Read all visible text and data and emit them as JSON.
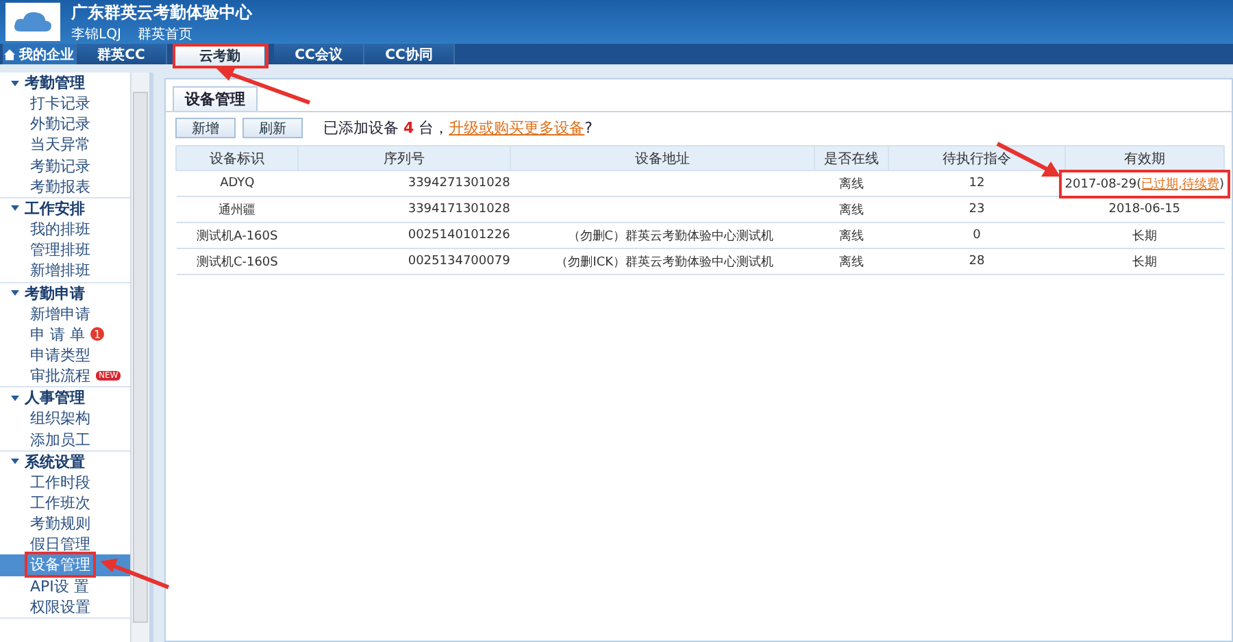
{
  "header": {
    "title": "广东群英云考勤体验中心",
    "user": "李锦LQJ",
    "home_link": "群英首页"
  },
  "nav": [
    {
      "label": "我的企业",
      "kind": "home",
      "selected": false,
      "highlighted": false
    },
    {
      "label": "群英CC",
      "kind": "plain",
      "selected": false,
      "highlighted": false
    },
    {
      "label": "云考勤",
      "kind": "plain",
      "selected": true,
      "highlighted": true
    },
    {
      "label": "CC会议",
      "kind": "plain",
      "selected": false,
      "highlighted": false
    },
    {
      "label": "CC协同",
      "kind": "plain",
      "selected": false,
      "highlighted": false
    }
  ],
  "sidebar": [
    {
      "label": "考勤管理",
      "expanded": true,
      "children": [
        {
          "label": "打卡记录",
          "selected": false
        },
        {
          "label": "外勤记录",
          "selected": false
        },
        {
          "label": "当天异常",
          "selected": false
        },
        {
          "label": "考勤记录",
          "selected": false
        },
        {
          "label": "考勤报表",
          "selected": false
        }
      ]
    },
    {
      "label": "工作安排",
      "expanded": true,
      "children": [
        {
          "label": "我的排班",
          "selected": false
        },
        {
          "label": "管理排班",
          "selected": false
        },
        {
          "label": "新增排班",
          "selected": false
        }
      ]
    },
    {
      "label": "考勤申请",
      "expanded": true,
      "children": [
        {
          "label": "新增申请",
          "selected": false
        },
        {
          "label": "申 请 单",
          "selected": false,
          "badge": "1"
        },
        {
          "label": "申请类型",
          "selected": false
        },
        {
          "label": "审批流程",
          "selected": false,
          "tag": "NEW"
        }
      ]
    },
    {
      "label": "人事管理",
      "expanded": true,
      "children": [
        {
          "label": "组织架构",
          "selected": false
        },
        {
          "label": "添加员工",
          "selected": false
        }
      ]
    },
    {
      "label": "系统设置",
      "expanded": true,
      "children": [
        {
          "label": "工作时段",
          "selected": false
        },
        {
          "label": "工作班次",
          "selected": false
        },
        {
          "label": "考勤规则",
          "selected": false
        },
        {
          "label": "假日管理",
          "selected": false
        },
        {
          "label": "设备管理",
          "selected": true,
          "highlighted": true
        },
        {
          "label": "API设 置",
          "selected": false
        },
        {
          "label": "权限设置",
          "selected": false
        }
      ]
    }
  ],
  "panel_tab": "设备管理",
  "toolbar": {
    "buttons": [
      "新增",
      "刷新"
    ],
    "notice": {
      "before": "已添加设备",
      "count": "4",
      "after": "台，",
      "link": "升级或购买更多设备",
      "end": "?"
    }
  },
  "table": {
    "columns": [
      "设备标识",
      "序列号",
      "设备地址",
      "是否在线",
      "待执行指令",
      "有效期"
    ],
    "rows": [
      {
        "name": "ADYQ",
        "serial": "3394271301028",
        "online": "离线",
        "pending": "12",
        "expiry": {
          "date": "2017-08-29",
          "open": "(",
          "link": "已过期,待续费",
          "close": ")",
          "highlighted": true
        }
      },
      {
        "name": "通州疆",
        "serial": "3394171301028",
        "online": "离线",
        "pending": "23",
        "expiry": {
          "date": "2018-06-15",
          "highlighted": false
        }
      },
      {
        "name": "测试机A-160S",
        "serial": "0025140101226",
        "address": "（勿删C）群英云考勤体验中心测试机",
        "online": "离线",
        "pending": "0",
        "expiry": {
          "date": "长期",
          "highlighted": false
        }
      },
      {
        "name": "测试机C-160S",
        "serial": "0025134700079",
        "address": "（勿删ICK）群英云考勤体验中心测试机",
        "online": "离线",
        "pending": "28",
        "expiry": {
          "date": "长期",
          "highlighted": false
        }
      }
    ]
  }
}
